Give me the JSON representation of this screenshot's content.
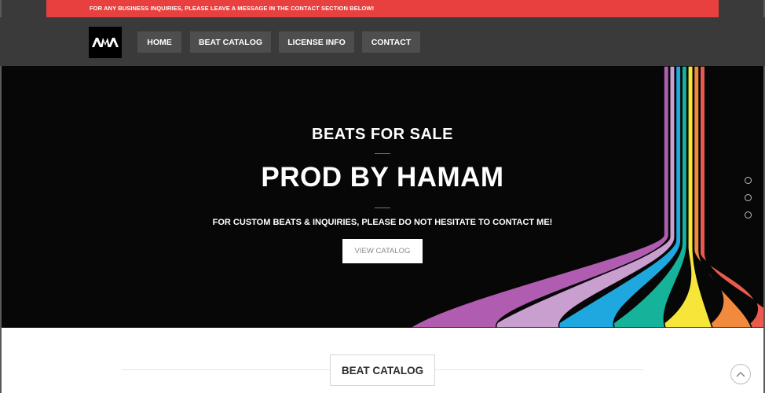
{
  "announcement": "FOR ANY BUSINESS INQUIRIES, PLEASE LEAVE A MESSAGE IN THE CONTACT SECTION BELOW!",
  "logo": {
    "text": "AMA",
    "icon": "ama-logo"
  },
  "nav": {
    "home": "HOME",
    "beat_catalog": "BEAT CATALOG",
    "license_info": "LICENSE INFO",
    "contact": "CONTACT"
  },
  "hero": {
    "eyebrow": "BEATS FOR SALE",
    "title": "PROD BY HAMAM",
    "subtitle": "FOR CUSTOM BEATS & INQUIRIES, PLEASE DO NOT HESITATE TO CONTACT ME!",
    "cta": "VIEW CATALOG",
    "slides": 3,
    "stripe_colors": [
      "#b05cb0",
      "#c99fd0",
      "#1fa8e0",
      "#14b39a",
      "#f6e63a",
      "#f28a3e",
      "#ea5a4e"
    ]
  },
  "section": {
    "title": "BEAT CATALOG"
  },
  "colors": {
    "accent": "#e8403f",
    "header_bg": "#3a3a3a",
    "nav_btn": "#4e4e4e"
  },
  "icons": {
    "scroll_top": "chevron-up-icon"
  }
}
